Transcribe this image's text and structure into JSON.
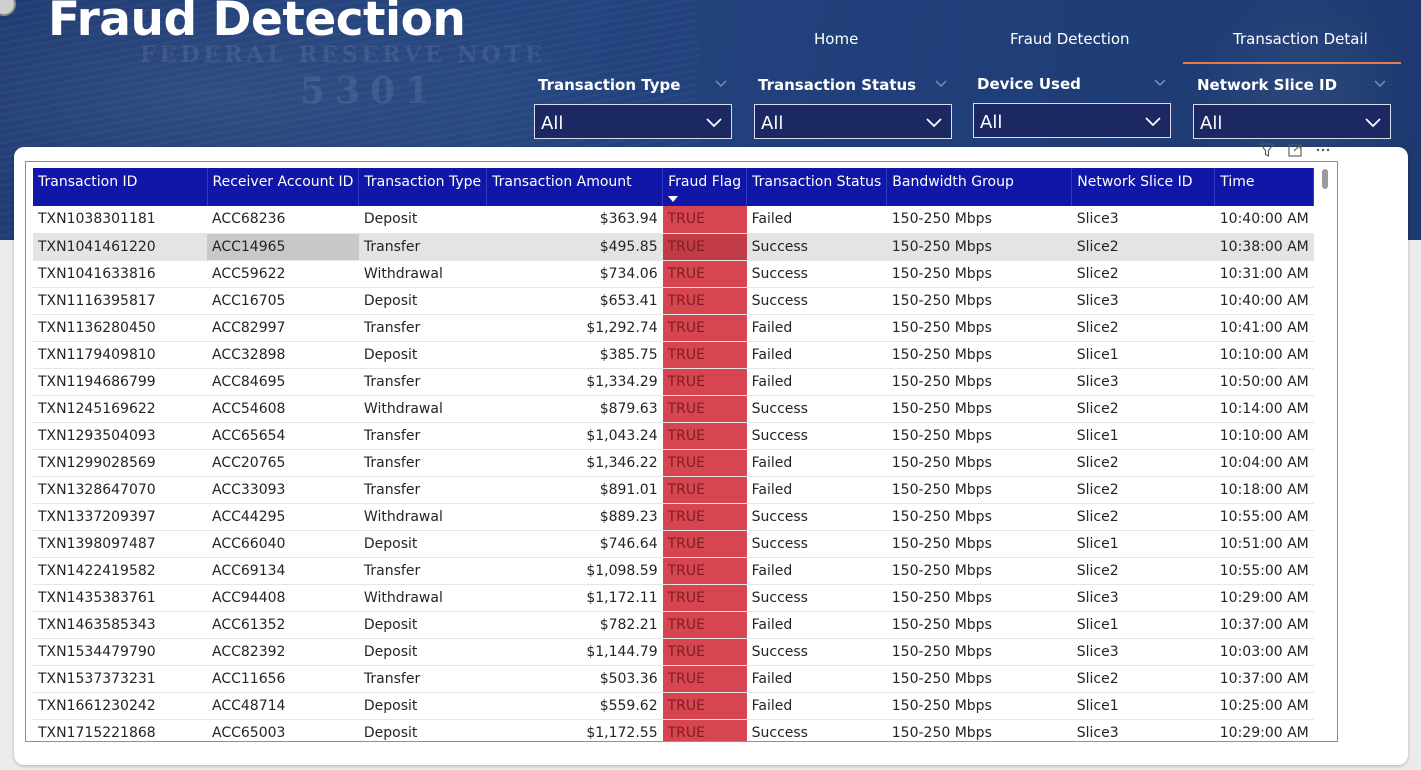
{
  "header": {
    "title": "Fraud Detection"
  },
  "nav": {
    "items": [
      {
        "label": "Home"
      },
      {
        "label": "Fraud Detection"
      },
      {
        "label": "Transaction Detail"
      }
    ],
    "active": "Transaction Detail",
    "accent_color": "#e8794f"
  },
  "slicers": [
    {
      "label": "Transaction Type",
      "value": "All"
    },
    {
      "label": "Transaction Status",
      "value": "All"
    },
    {
      "label": "Device Used",
      "value": "All"
    },
    {
      "label": "Network Slice ID",
      "value": "All"
    }
  ],
  "visual_header_icons": [
    "filter-icon",
    "focus-mode-icon",
    "more-options-icon"
  ],
  "table": {
    "header_color": "#0f16a8",
    "flag_color": "#d64550",
    "sorted_column": "Fraud Flag",
    "columns": [
      "Transaction ID",
      "Receiver Account ID",
      "Transaction Type",
      "Transaction Amount",
      "Fraud Flag",
      "Transaction Status",
      "Bandwidth Group",
      "Network Slice ID",
      "Time"
    ],
    "rows": [
      [
        "TXN1038301181",
        "ACC68236",
        "Deposit",
        "$363.94",
        "TRUE",
        "Failed",
        "150-250 Mbps",
        "Slice3",
        "10:40:00 AM"
      ],
      [
        "TXN1041461220",
        "ACC14965",
        "Transfer",
        "$495.85",
        "TRUE",
        "Success",
        "150-250 Mbps",
        "Slice2",
        "10:38:00 AM"
      ],
      [
        "TXN1041633816",
        "ACC59622",
        "Withdrawal",
        "$734.06",
        "TRUE",
        "Success",
        "150-250 Mbps",
        "Slice2",
        "10:31:00 AM"
      ],
      [
        "TXN1116395817",
        "ACC16705",
        "Deposit",
        "$653.41",
        "TRUE",
        "Success",
        "150-250 Mbps",
        "Slice3",
        "10:40:00 AM"
      ],
      [
        "TXN1136280450",
        "ACC82997",
        "Transfer",
        "$1,292.74",
        "TRUE",
        "Failed",
        "150-250 Mbps",
        "Slice2",
        "10:41:00 AM"
      ],
      [
        "TXN1179409810",
        "ACC32898",
        "Deposit",
        "$385.75",
        "TRUE",
        "Failed",
        "150-250 Mbps",
        "Slice1",
        "10:10:00 AM"
      ],
      [
        "TXN1194686799",
        "ACC84695",
        "Transfer",
        "$1,334.29",
        "TRUE",
        "Failed",
        "150-250 Mbps",
        "Slice3",
        "10:50:00 AM"
      ],
      [
        "TXN1245169622",
        "ACC54608",
        "Withdrawal",
        "$879.63",
        "TRUE",
        "Success",
        "150-250 Mbps",
        "Slice2",
        "10:14:00 AM"
      ],
      [
        "TXN1293504093",
        "ACC65654",
        "Transfer",
        "$1,043.24",
        "TRUE",
        "Success",
        "150-250 Mbps",
        "Slice1",
        "10:10:00 AM"
      ],
      [
        "TXN1299028569",
        "ACC20765",
        "Transfer",
        "$1,346.22",
        "TRUE",
        "Failed",
        "150-250 Mbps",
        "Slice2",
        "10:04:00 AM"
      ],
      [
        "TXN1328647070",
        "ACC33093",
        "Transfer",
        "$891.01",
        "TRUE",
        "Failed",
        "150-250 Mbps",
        "Slice2",
        "10:18:00 AM"
      ],
      [
        "TXN1337209397",
        "ACC44295",
        "Withdrawal",
        "$889.23",
        "TRUE",
        "Success",
        "150-250 Mbps",
        "Slice2",
        "10:55:00 AM"
      ],
      [
        "TXN1398097487",
        "ACC66040",
        "Deposit",
        "$746.64",
        "TRUE",
        "Success",
        "150-250 Mbps",
        "Slice1",
        "10:51:00 AM"
      ],
      [
        "TXN1422419582",
        "ACC69134",
        "Transfer",
        "$1,098.59",
        "TRUE",
        "Failed",
        "150-250 Mbps",
        "Slice2",
        "10:55:00 AM"
      ],
      [
        "TXN1435383761",
        "ACC94408",
        "Withdrawal",
        "$1,172.11",
        "TRUE",
        "Success",
        "150-250 Mbps",
        "Slice3",
        "10:29:00 AM"
      ],
      [
        "TXN1463585343",
        "ACC61352",
        "Deposit",
        "$782.21",
        "TRUE",
        "Failed",
        "150-250 Mbps",
        "Slice1",
        "10:37:00 AM"
      ],
      [
        "TXN1534479790",
        "ACC82392",
        "Deposit",
        "$1,144.79",
        "TRUE",
        "Success",
        "150-250 Mbps",
        "Slice3",
        "10:03:00 AM"
      ],
      [
        "TXN1537373231",
        "ACC11656",
        "Transfer",
        "$503.36",
        "TRUE",
        "Failed",
        "150-250 Mbps",
        "Slice2",
        "10:37:00 AM"
      ],
      [
        "TXN1661230242",
        "ACC48714",
        "Deposit",
        "$559.62",
        "TRUE",
        "Failed",
        "150-250 Mbps",
        "Slice1",
        "10:25:00 AM"
      ],
      [
        "TXN1715221868",
        "ACC65003",
        "Deposit",
        "$1,172.55",
        "TRUE",
        "Success",
        "150-250 Mbps",
        "Slice3",
        "10:29:00 AM"
      ]
    ]
  }
}
